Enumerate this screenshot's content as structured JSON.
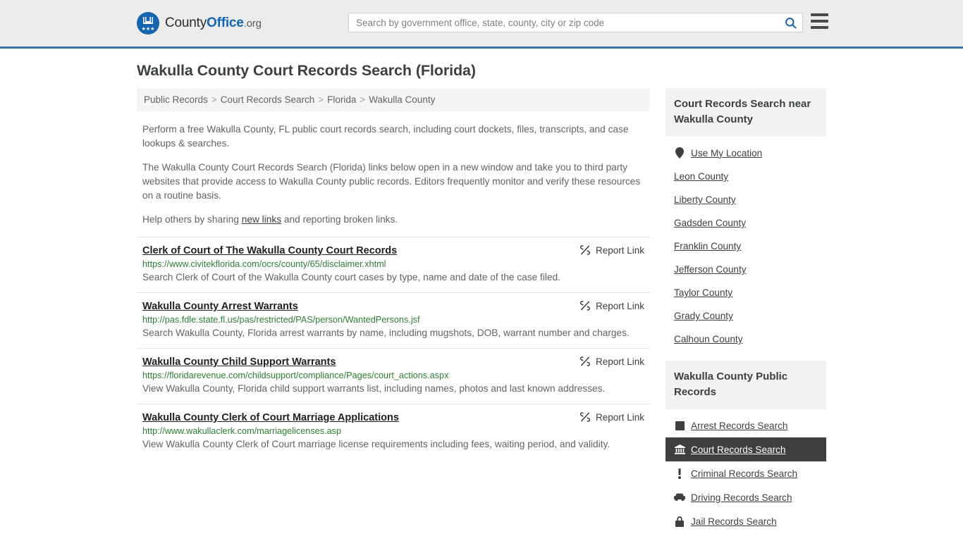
{
  "header": {
    "brand": {
      "part1": "County",
      "part2": "Office",
      "part3": ".org"
    },
    "search": {
      "placeholder": "Search by government office, state, county, city or zip code",
      "value": ""
    },
    "search_icon": "search-icon",
    "menu_icon": "hamburger-menu-icon"
  },
  "page": {
    "title": "Wakulla County Court Records Search (Florida)"
  },
  "breadcrumb": {
    "items": [
      "Public Records",
      "Court Records Search",
      "Florida",
      "Wakulla County"
    ],
    "separator": ">"
  },
  "intro": {
    "p1": "Perform a free Wakulla County, FL public court records search, including court dockets, files, transcripts, and case lookups & searches.",
    "p2": "The Wakulla County Court Records Search (Florida) links below open in a new window and take you to third party websites that provide access to Wakulla County public records. Editors frequently monitor and verify these resources on a routine basis.",
    "p3_before": "Help others by sharing ",
    "p3_link": "new links",
    "p3_after": " and reporting broken links."
  },
  "report_label": "Report Link",
  "results": [
    {
      "title": "Clerk of Court of The Wakulla County Court Records",
      "url": "https://www.civitekflorida.com/ocrs/county/65/disclaimer.xhtml",
      "description": "Search Clerk of Court of the Wakulla County court cases by type, name and date of the case filed.",
      "report": "Report Link"
    },
    {
      "title": "Wakulla County Arrest Warrants",
      "url": "http://pas.fdle.state.fl.us/pas/restricted/PAS/person/WantedPersons.jsf",
      "description": "Search Wakulla County, Florida arrest warrants by name, including mugshots, DOB, warrant number and charges.",
      "report": "Report Link"
    },
    {
      "title": "Wakulla County Child Support Warrants",
      "url": "https://floridarevenue.com/childsupport/compliance/Pages/court_actions.aspx",
      "description": "View Wakulla County, Florida child support warrants list, including names, photos and last known addresses.",
      "report": "Report Link"
    },
    {
      "title": "Wakulla County Clerk of Court Marriage Applications",
      "url": "http://www.wakullaclerk.com/marriagelicenses.asp",
      "description": "View Wakulla County Clerk of Court marriage license requirements including fees, waiting period, and validity.",
      "report": "Report Link"
    }
  ],
  "sidebar": {
    "nearby": {
      "heading": "Court Records Search near Wakulla County",
      "use_my_location": {
        "label": "Use My Location",
        "icon": "map-pin-icon"
      },
      "counties": [
        "Leon County",
        "Liberty County",
        "Gadsden County",
        "Franklin County",
        "Jefferson County",
        "Taylor County",
        "Grady County",
        "Calhoun County"
      ]
    },
    "public_records": {
      "heading": "Wakulla County Public Records",
      "items": [
        {
          "label": "Arrest Records Search",
          "icon": "fingerprint-icon",
          "active": false
        },
        {
          "label": "Court Records Search",
          "icon": "courthouse-icon",
          "active": true
        },
        {
          "label": "Criminal Records Search",
          "icon": "exclamation-icon",
          "active": false
        },
        {
          "label": "Driving Records Search",
          "icon": "car-icon",
          "active": false
        },
        {
          "label": "Jail Records Search",
          "icon": "lock-icon",
          "active": false
        }
      ]
    }
  },
  "colors": {
    "header_bg": "#ececec",
    "header_border": "#3a72a8",
    "brand_blue": "#1565b0",
    "url_green": "#2e7d32",
    "panel_head_bg": "#f2f2f2",
    "active_bg": "#3f3f3f",
    "text": "#3c4043"
  }
}
